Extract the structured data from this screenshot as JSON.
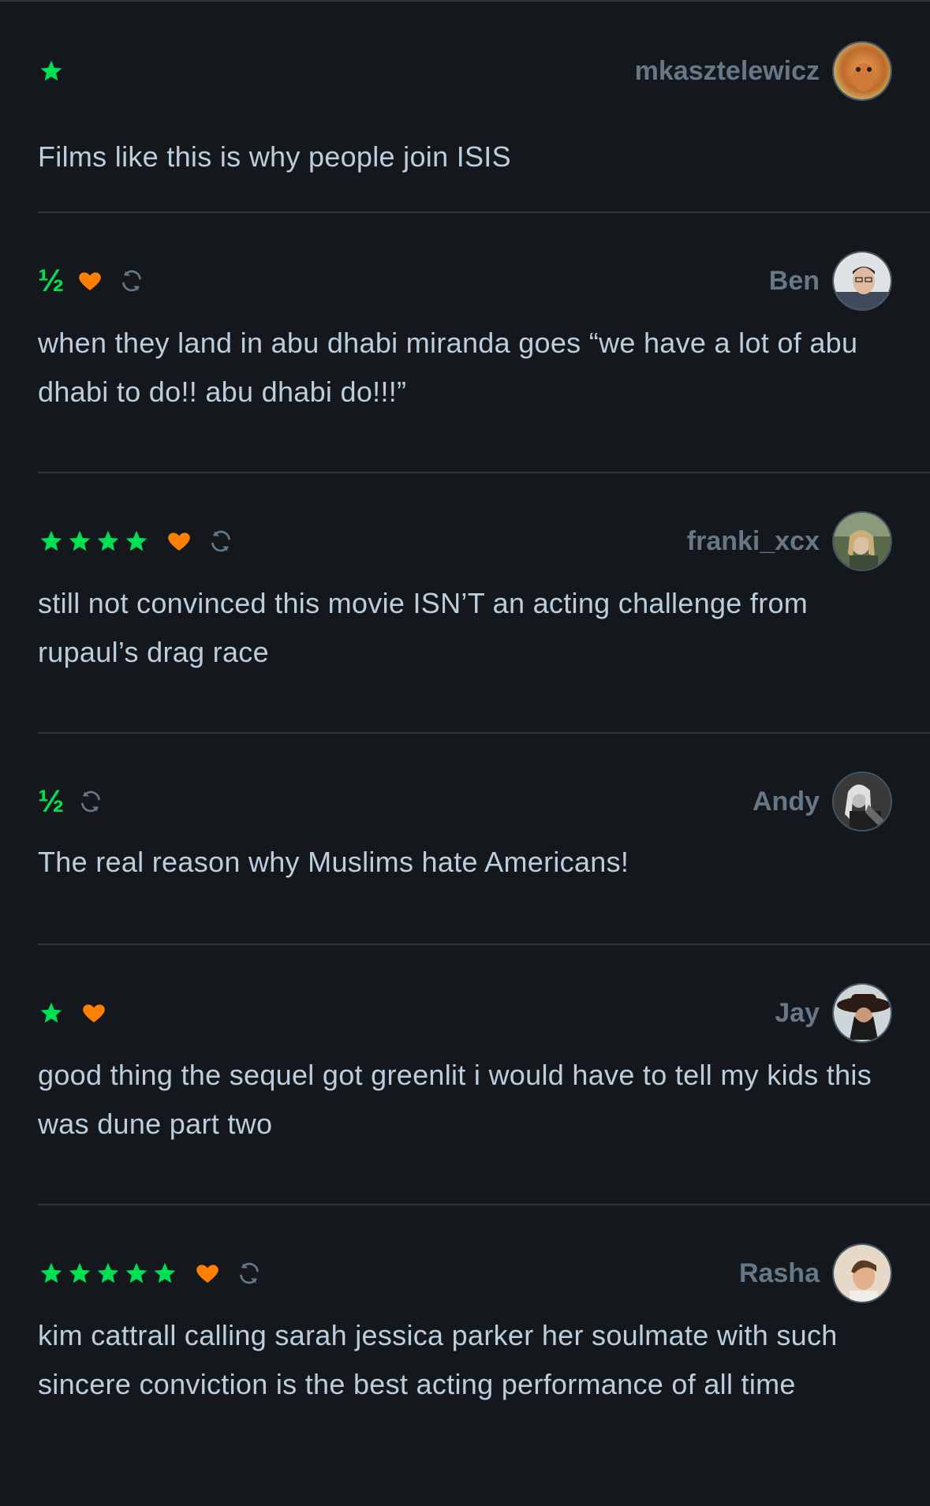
{
  "colors": {
    "background": "#14181c",
    "divider": "#2c3440",
    "star": "#00e054",
    "like": "#ff8000",
    "rewatch": "#667788",
    "username": "#667788",
    "body_text": "#bccddd"
  },
  "reviews": [
    {
      "username": "mkasztelewicz",
      "stars": 1,
      "half_star": false,
      "liked": false,
      "rewatch": false,
      "text": "Films like this is why people join ISIS"
    },
    {
      "username": "Ben",
      "stars": 0,
      "half_star": true,
      "half_symbol": "½",
      "liked": true,
      "rewatch": true,
      "text": "when they land in abu dhabi miranda goes “we have a lot of abu dhabi to do!! abu dhabi do!!!”"
    },
    {
      "username": "franki_xcx",
      "stars": 4,
      "half_star": false,
      "liked": true,
      "rewatch": true,
      "text": "still not convinced this movie ISN’T an acting challenge from rupaul’s drag race"
    },
    {
      "username": "Andy",
      "stars": 0,
      "half_star": true,
      "half_symbol": "½",
      "liked": false,
      "rewatch": true,
      "text": "The real reason why Muslims hate Americans!"
    },
    {
      "username": "Jay",
      "stars": 1,
      "half_star": false,
      "liked": true,
      "rewatch": false,
      "text": "good thing the sequel got greenlit i would have to tell my kids this was dune part two"
    },
    {
      "username": "Rasha",
      "stars": 5,
      "half_star": false,
      "liked": true,
      "rewatch": true,
      "text": "kim cattrall calling sarah jessica parker her soulmate with such sincere conviction is the best acting performance of all time"
    }
  ],
  "icons": {
    "star": "star-icon",
    "like": "heart-icon",
    "rewatch": "rewatch-icon"
  }
}
